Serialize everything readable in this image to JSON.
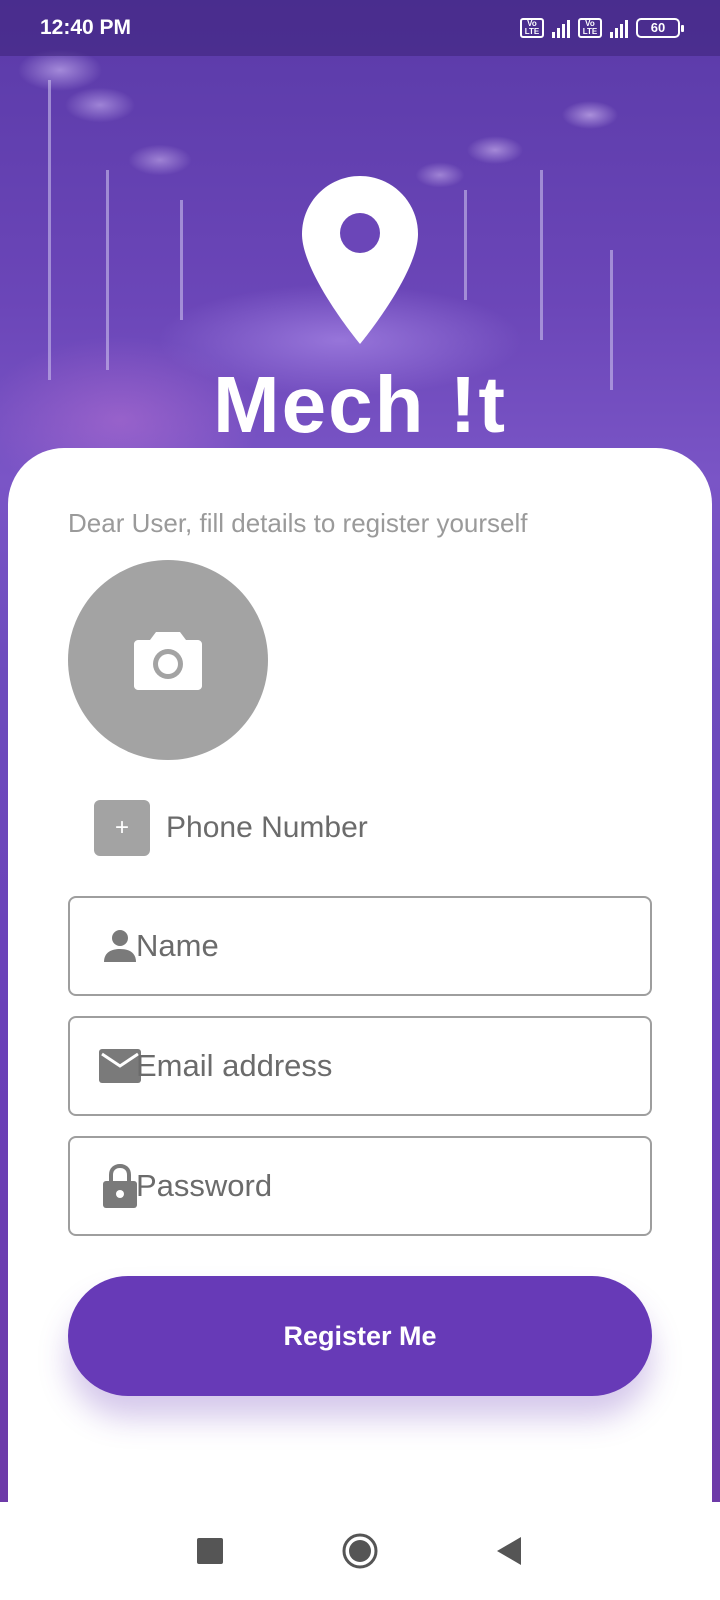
{
  "status_bar": {
    "time": "12:40 PM",
    "volte_label_top": "Vo",
    "volte_label_bottom": "LTE",
    "battery": "60"
  },
  "app": {
    "title": "Mech !t",
    "logo_icon": "location-pin-icon"
  },
  "form": {
    "instruction": "Dear User, fill details to register yourself",
    "avatar_icon": "camera-icon",
    "country_code_button": "+",
    "phone_placeholder": "Phone Number",
    "name_placeholder": "Name",
    "email_placeholder": "Email address",
    "password_placeholder": "Password",
    "submit_label": "Register Me"
  },
  "nav": {
    "icons": [
      "recents-square-icon",
      "home-circle-icon",
      "back-triangle-icon"
    ]
  },
  "colors": {
    "primary": "#673ab7",
    "placeholder_gray": "#a3a3a3",
    "text_gray": "#6b6b6b"
  }
}
